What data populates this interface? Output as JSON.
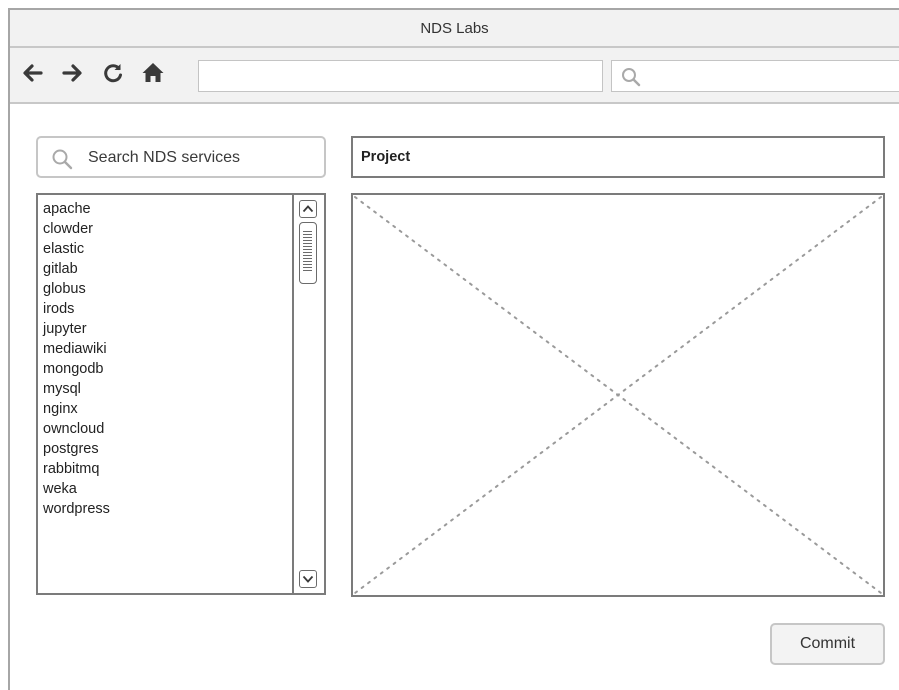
{
  "window": {
    "title": "NDS Labs"
  },
  "toolbar": {
    "back_icon": "arrow-left-icon",
    "forward_icon": "arrow-right-icon",
    "reload_icon": "reload-icon",
    "home_icon": "home-icon",
    "url_value": "",
    "search_value": ""
  },
  "services": {
    "search_placeholder": "Search NDS services",
    "items": [
      "apache",
      "clowder",
      "elastic",
      "gitlab",
      "globus",
      "irods",
      "jupyter",
      "mediawiki",
      "mongodb",
      "mysql",
      "nginx",
      "owncloud",
      "postgres",
      "rabbitmq",
      "weka",
      "wordpress"
    ]
  },
  "project": {
    "placeholder": "Project",
    "value": ""
  },
  "actions": {
    "commit_label": "Commit"
  },
  "colors": {
    "chrome_bg": "#f2f2f2",
    "border": "#7b7b7b",
    "light_border": "#c6c6c6",
    "placeholder_lines": "#9a9a9a"
  }
}
